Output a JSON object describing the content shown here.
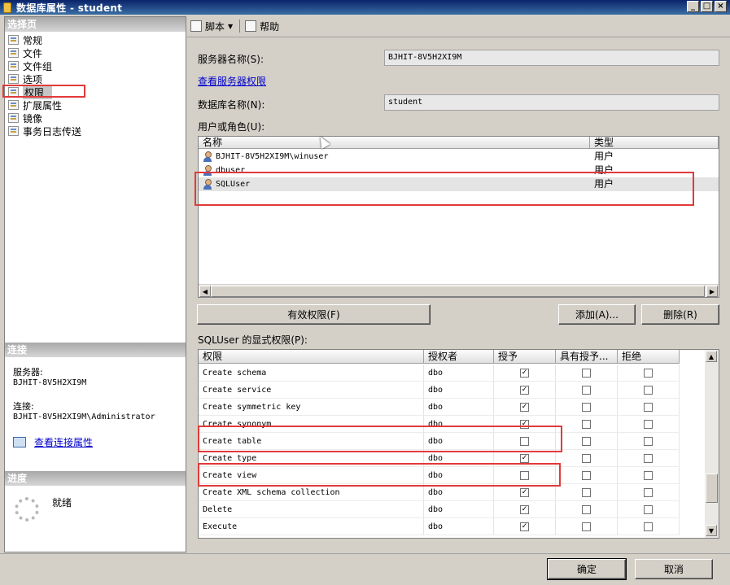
{
  "window": {
    "title": "数据库属性 - student",
    "minimize": "_",
    "maximize": "□",
    "close": "×"
  },
  "left": {
    "select_page_header": "选择页",
    "pages": [
      {
        "label": "常规"
      },
      {
        "label": "文件"
      },
      {
        "label": "文件组"
      },
      {
        "label": "选项"
      },
      {
        "label": "权限",
        "selected": true
      },
      {
        "label": "扩展属性"
      },
      {
        "label": "镜像"
      },
      {
        "label": "事务日志传送"
      }
    ],
    "connection_header": "连接",
    "server_label": "服务器:",
    "server_value": "BJHIT-8V5H2XI9M",
    "connection_label": "连接:",
    "connection_value": "BJHIT-8V5H2XI9M\\Administrator",
    "view_connection_link": "查看连接属性",
    "progress_header": "进度",
    "progress_status": "就绪"
  },
  "toolbar": {
    "script_label": "脚本",
    "help_label": "帮助"
  },
  "main": {
    "server_name_label": "服务器名称(S):",
    "server_name_value": "BJHIT-8V5H2XI9M",
    "view_server_permissions_link": "查看服务器权限",
    "db_name_label": "数据库名称(N):",
    "db_name_value": "student",
    "users_roles_label": "用户或角色(U):",
    "users_columns": {
      "name": "名称",
      "type": "类型"
    },
    "users": [
      {
        "name": "BJHIT-8V5H2XI9M\\winuser",
        "type": "用户"
      },
      {
        "name": "dbuser",
        "type": "用户"
      },
      {
        "name": "SQLUser",
        "type": "用户",
        "selected": true
      }
    ],
    "effective_permissions_button": "有效权限(F)",
    "add_button": "添加(A)...",
    "remove_button": "删除(R)",
    "explicit_permissions_label": "SQLUser 的显式权限(P):",
    "perm_columns": {
      "permission": "权限",
      "grantor": "授权者",
      "grant": "授予",
      "with_grant": "具有授予...",
      "deny": "拒绝"
    },
    "permissions": [
      {
        "name": "Create schema",
        "grantor": "dbo",
        "grant": true,
        "with_grant": false,
        "deny": false
      },
      {
        "name": "Create service",
        "grantor": "dbo",
        "grant": true,
        "with_grant": false,
        "deny": false
      },
      {
        "name": "Create symmetric key",
        "grantor": "dbo",
        "grant": true,
        "with_grant": false,
        "deny": false
      },
      {
        "name": "Create synonym",
        "grantor": "dbo",
        "grant": true,
        "with_grant": false,
        "deny": false
      },
      {
        "name": "Create table",
        "grantor": "dbo",
        "grant": false,
        "with_grant": false,
        "deny": false
      },
      {
        "name": "Create type",
        "grantor": "dbo",
        "grant": true,
        "with_grant": false,
        "deny": false
      },
      {
        "name": "Create view",
        "grantor": "dbo",
        "grant": false,
        "with_grant": false,
        "deny": false
      },
      {
        "name": "Create XML schema collection",
        "grantor": "dbo",
        "grant": true,
        "with_grant": false,
        "deny": false
      },
      {
        "name": "Delete",
        "grantor": "dbo",
        "grant": true,
        "with_grant": false,
        "deny": false
      },
      {
        "name": "Execute",
        "grantor": "dbo",
        "grant": true,
        "with_grant": false,
        "deny": false
      }
    ],
    "ok_button": "确定",
    "cancel_button": "取消"
  },
  "colors": {
    "highlight_box": "#e03a3a",
    "title_bar": "#0a246a",
    "link": "#0000cc"
  }
}
